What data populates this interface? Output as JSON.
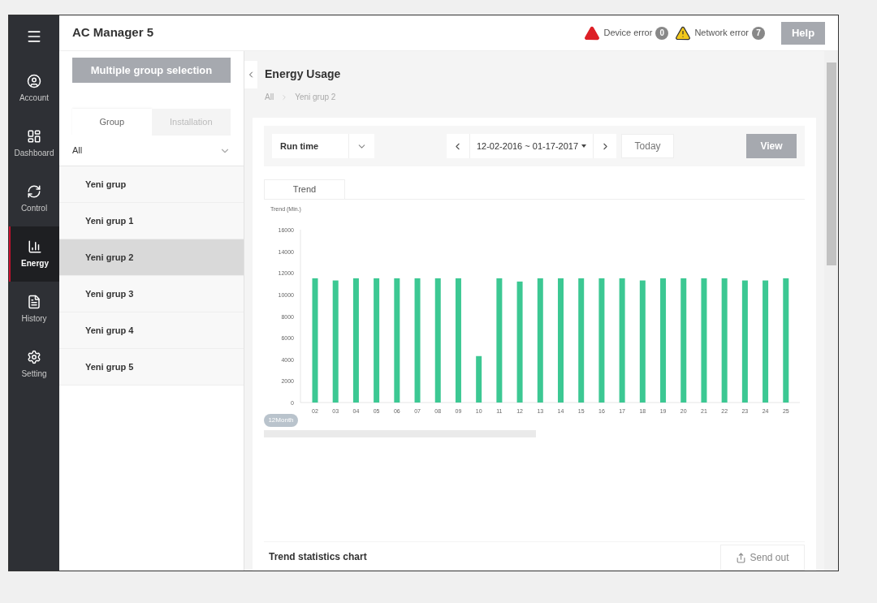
{
  "app_title": "AC Manager 5",
  "nav": [
    {
      "label": "Account",
      "selected": false
    },
    {
      "label": "Dashboard",
      "selected": false
    },
    {
      "label": "Control",
      "selected": false
    },
    {
      "label": "Energy",
      "selected": true
    },
    {
      "label": "History",
      "selected": false
    },
    {
      "label": "Setting",
      "selected": false
    }
  ],
  "errors": [
    {
      "label": "Device error",
      "count": "0",
      "color": "#dd1f26"
    },
    {
      "label": "Network error",
      "count": "7",
      "color": "#f2c81c"
    }
  ],
  "help_button": "Help",
  "multi_select_button": "Multiple group selection",
  "panel_tabs": [
    {
      "label": "Group",
      "selected": true
    },
    {
      "label": "Installation",
      "selected": false
    }
  ],
  "filter": {
    "value": "All"
  },
  "groups": [
    {
      "label": "Yeni grup",
      "selected": false
    },
    {
      "label": "Yeni grup 1",
      "selected": false
    },
    {
      "label": "Yeni grup 2",
      "selected": true
    },
    {
      "label": "Yeni grup 3",
      "selected": false
    },
    {
      "label": "Yeni grup 4",
      "selected": false
    },
    {
      "label": "Yeni grup 5",
      "selected": false
    }
  ],
  "page_title": "Energy Usage",
  "breadcrumb": [
    "All",
    "Yeni grup 2"
  ],
  "metric_select": {
    "value": "Run time"
  },
  "date_range": "12-02-2016 ~ 01-17-2017",
  "today_button": "Today",
  "view_button": "View",
  "chart_tabs": [
    "Trend"
  ],
  "chart_data": {
    "type": "bar",
    "ylabel": "Trend (Min.)",
    "categories": [
      "02",
      "03",
      "04",
      "05",
      "06",
      "07",
      "08",
      "09",
      "10",
      "11",
      "12",
      "13",
      "14",
      "15",
      "16",
      "17",
      "18",
      "19",
      "20",
      "21",
      "22",
      "23",
      "24",
      "25"
    ],
    "series": [
      {
        "color": "#3cc893",
        "values": [
          11500,
          11300,
          11500,
          11500,
          11500,
          11500,
          11500,
          11500,
          4300,
          11500,
          11200,
          11500,
          11500,
          11500,
          11500,
          11500,
          11300,
          11500,
          11500,
          11500,
          11500,
          11300,
          11300,
          11500
        ]
      }
    ],
    "ylim": [
      0,
      16000
    ],
    "yticks": [
      0,
      2000,
      4000,
      6000,
      8000,
      10000,
      12000,
      14000,
      16000
    ]
  },
  "period_badge": "12Month",
  "stats_title": "Trend statistics chart",
  "send_button": "Send out"
}
